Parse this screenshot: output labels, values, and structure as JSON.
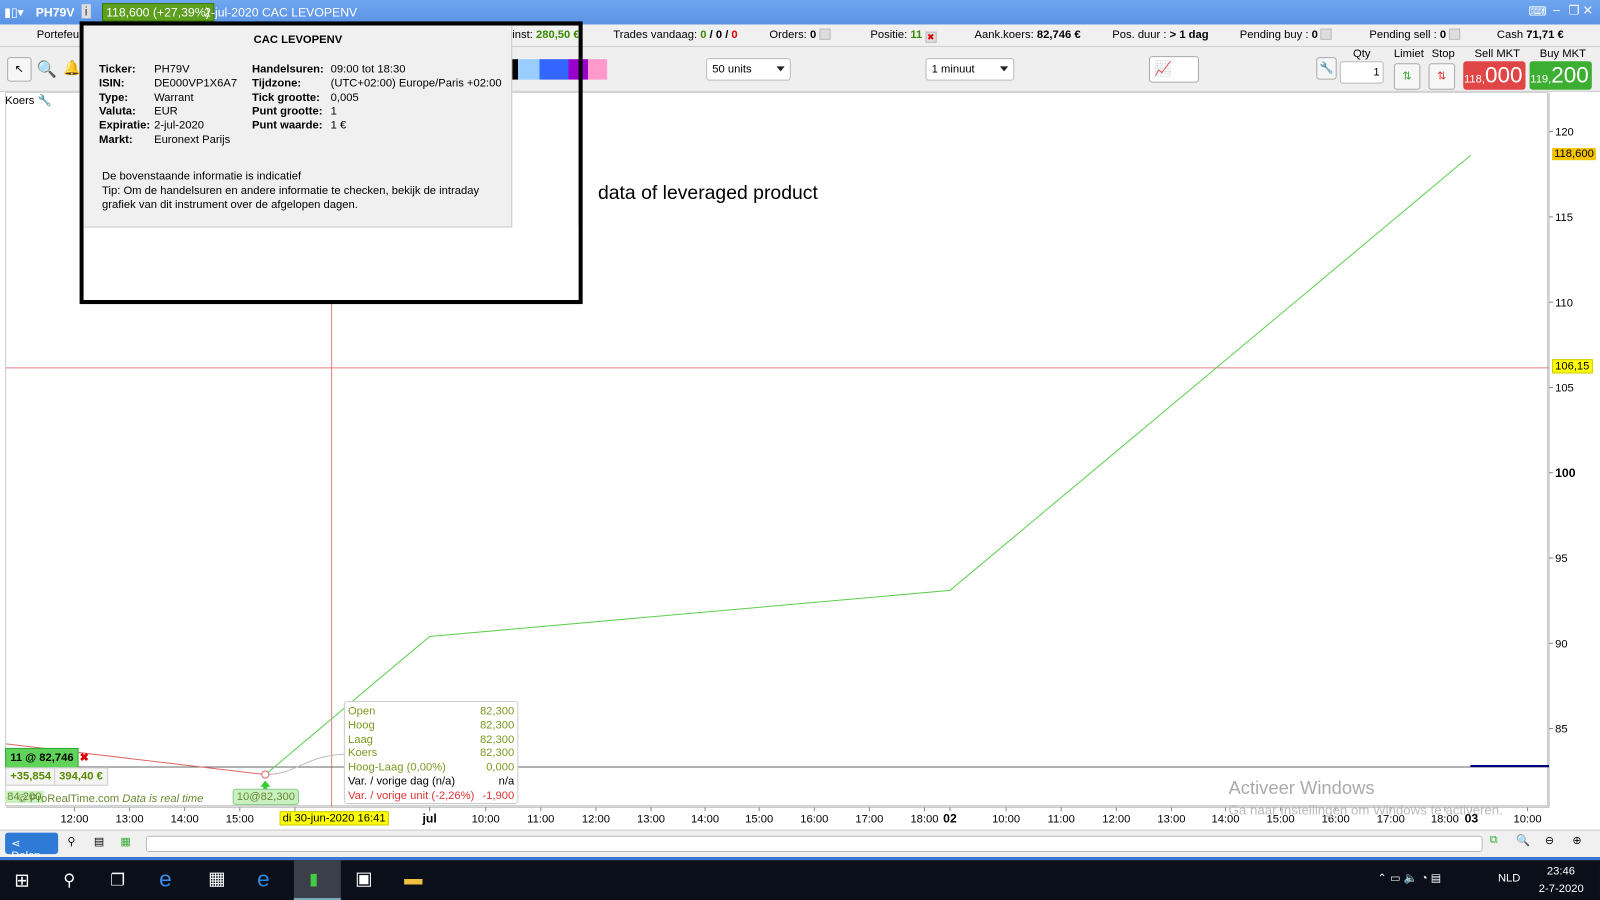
{
  "titlebar": {
    "ticker": "PH79V",
    "price_change": "118,600 (+27,39%)",
    "date_name": "2-jul-2020 CAC LEVOPENV"
  },
  "status": {
    "portfolio_label": "Portefeu",
    "winst_label": "inst:",
    "winst_value": "280,50 €",
    "trades_label": "Trades vandaag:",
    "trades_a": "0",
    "trades_b": "0",
    "trades_c": "0",
    "orders_label": "Orders:",
    "orders_value": "0",
    "positie_label": "Positie:",
    "positie_value": "11",
    "aank_label": "Aank.koers:",
    "aank_value": "82,746 €",
    "duur_label": "Pos. duur :",
    "duur_value": "> 1 dag",
    "pbuy_label": "Pending buy :",
    "pbuy_value": "0",
    "psell_label": "Pending sell :",
    "psell_value": "0",
    "cash_label": "Cash",
    "cash_value": "71,71 €"
  },
  "toolbar": {
    "units": "50 units",
    "interval": "1 minuut",
    "qty_label": "Qty",
    "qty_value": "1",
    "limiet": "Limiet",
    "stop": "Stop",
    "sell_label": "Sell MKT",
    "sell_small": "118,",
    "sell_big": "000",
    "buy_label": "Buy MKT",
    "buy_small": "119,",
    "buy_big": "200",
    "koers_label": "Koers"
  },
  "info": {
    "title": "CAC LEVOPENV",
    "left": [
      [
        "Ticker:",
        "PH79V"
      ],
      [
        "ISIN:",
        "DE000VP1X6A7"
      ],
      [
        "Type:",
        "Warrant"
      ],
      [
        "Valuta:",
        "EUR"
      ],
      [
        "Expiratie:",
        "2-jul-2020"
      ],
      [
        "Markt:",
        "Euronext Parijs"
      ]
    ],
    "right": [
      [
        "Handelsuren:",
        "09:00 tot 18:30"
      ],
      [
        "Tijdzone:",
        "(UTC+02:00) Europe/Paris +02:00"
      ],
      [
        "Tick grootte:",
        "0,005"
      ],
      [
        "Punt grootte:",
        "1"
      ],
      [
        "Punt waarde:",
        "1 €"
      ]
    ],
    "note1": "De bovenstaande informatie is indicatief",
    "note2": "Tip: Om de handelsuren en andere informatie te checken, bekijk de intraday",
    "note3": "grafiek van dit instrument over de afgelopen dagen."
  },
  "annotation": "data  of leveraged product",
  "tooltip": [
    [
      "Open",
      "82,300"
    ],
    [
      "Hoog",
      "82,300"
    ],
    [
      "Laag",
      "82,300"
    ],
    [
      "Koers",
      "82,300"
    ],
    [
      "Hoog-Laag (0,00%)",
      "0,000"
    ],
    [
      "Var. / vorige dag (n/a)",
      "n/a"
    ],
    [
      "Var. / vorige unit (-2,26%)",
      "-1,900"
    ]
  ],
  "position": {
    "label": "11 @ 82,746",
    "pl": "+35,854",
    "value": "394,40 €",
    "trade_marker": "10@82,300",
    "partial": "84,200"
  },
  "credit": "© ProRealTime.com",
  "credit2": "Data is real time",
  "crosshair": {
    "date": "di 30-jun-2020 16:41",
    "price": "106,15"
  },
  "watermark": {
    "line1": "Activeer Windows",
    "line2": "Ga naar Instellingen om Windows te activeren."
  },
  "bottom": {
    "share": "Delen"
  },
  "taskbar": {
    "lang": "NLD",
    "time": "23:46",
    "date": "2-7-2020"
  },
  "colors": {
    "line": "#5ccf4e",
    "sell": "#e04646",
    "buy": "#3cae32",
    "crosshair": "#e08080"
  },
  "chart_data": {
    "type": "line",
    "y_ticks": [
      85,
      90,
      95,
      100,
      105,
      110,
      115,
      120
    ],
    "ylim": [
      81.5,
      122
    ],
    "x_ticks": [
      "12:00",
      "13:00",
      "14:00",
      "15:00",
      "16:00",
      "jul",
      "10:00",
      "11:00",
      "12:00",
      "13:00",
      "14:00",
      "15:00",
      "16:00",
      "17:00",
      "18:00",
      "02",
      "10:00",
      "11:00",
      "12:00",
      "13:00",
      "14:00",
      "15:00",
      "16:00",
      "17:00",
      "18:00",
      "03",
      "10:00"
    ],
    "series": [
      {
        "values": [
          {
            "t": "30-jun 15:30",
            "v": 82.3
          },
          {
            "t": "1-jul 09:00",
            "v": 90.4
          },
          {
            "t": "2-jul 09:00",
            "v": 93.1
          },
          {
            "t": "2-jul 18:30",
            "v": 118.6
          }
        ]
      }
    ],
    "last_price": "118,600",
    "avg_price_line": 82.746
  }
}
